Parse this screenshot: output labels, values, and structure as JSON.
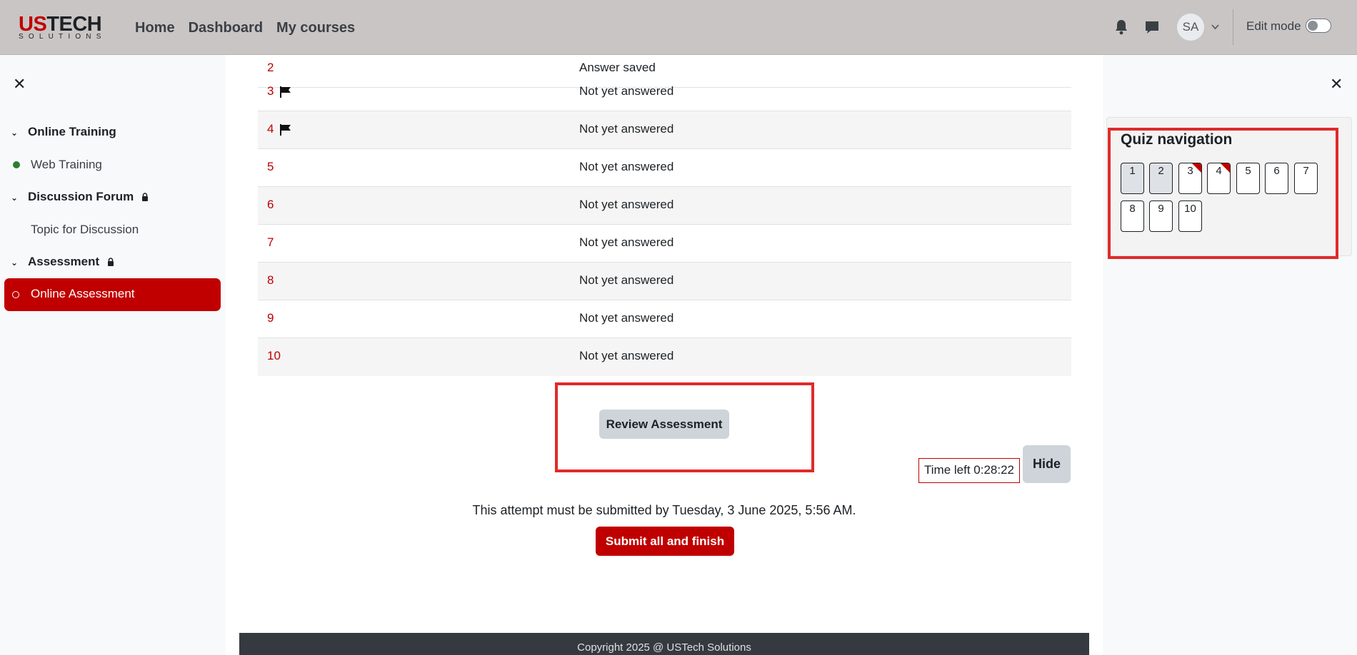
{
  "brand": {
    "main_red": "US",
    "main_dark": "TECH",
    "sub": "SOLUTIONS"
  },
  "nav": {
    "links": [
      "Home",
      "Dashboard",
      "My courses"
    ]
  },
  "user": {
    "initials": "SA",
    "edit_mode_label": "Edit mode",
    "edit_mode_on": false
  },
  "course_index": {
    "sections": [
      {
        "title": "Online Training",
        "locked": false,
        "items": [
          {
            "label": "Web Training",
            "state": "complete"
          }
        ]
      },
      {
        "title": "Discussion Forum",
        "locked": true,
        "items": [
          {
            "label": "Topic for Discussion",
            "state": "none"
          }
        ]
      },
      {
        "title": "Assessment",
        "locked": true,
        "items": [
          {
            "label": "Online Assessment",
            "state": "current"
          }
        ]
      }
    ]
  },
  "summary": {
    "rows": [
      {
        "num": "2",
        "status": "Answer saved",
        "flagged": false
      },
      {
        "num": "3",
        "status": "Not yet answered",
        "flagged": true
      },
      {
        "num": "4",
        "status": "Not yet answered",
        "flagged": true
      },
      {
        "num": "5",
        "status": "Not yet answered",
        "flagged": false
      },
      {
        "num": "6",
        "status": "Not yet answered",
        "flagged": false
      },
      {
        "num": "7",
        "status": "Not yet answered",
        "flagged": false
      },
      {
        "num": "8",
        "status": "Not yet answered",
        "flagged": false
      },
      {
        "num": "9",
        "status": "Not yet answered",
        "flagged": false
      },
      {
        "num": "10",
        "status": "Not yet answered",
        "flagged": false
      }
    ],
    "review_button": "Review Assessment",
    "timer": "Time left 0:28:22",
    "hide_button": "Hide",
    "submit_note": "This attempt must be submitted by Tuesday, 3 June 2025, 5:56 AM.",
    "submit_button": "Submit all and finish"
  },
  "footer": {
    "text": "Copyright 2025 @ USTech Solutions"
  },
  "quiz_nav": {
    "title": "Quiz navigation",
    "buttons": [
      {
        "label": "1",
        "answered": true,
        "flagged": false
      },
      {
        "label": "2",
        "answered": true,
        "flagged": false
      },
      {
        "label": "3",
        "answered": false,
        "flagged": true
      },
      {
        "label": "4",
        "answered": false,
        "flagged": true
      },
      {
        "label": "5",
        "answered": false,
        "flagged": false
      },
      {
        "label": "6",
        "answered": false,
        "flagged": false
      },
      {
        "label": "7",
        "answered": false,
        "flagged": false
      },
      {
        "label": "8",
        "answered": false,
        "flagged": false
      },
      {
        "label": "9",
        "answered": false,
        "flagged": false
      },
      {
        "label": "10",
        "answered": false,
        "flagged": false
      }
    ]
  },
  "colors": {
    "brand_red": "#c00000",
    "navbar": "#c9c5c5",
    "complete_dot": "#2e7d32",
    "highlight": "#e02a2a"
  },
  "icons": [
    "bell-icon",
    "chat-icon",
    "chevron-down-icon",
    "close-icon",
    "lock-icon",
    "flag-icon"
  ]
}
